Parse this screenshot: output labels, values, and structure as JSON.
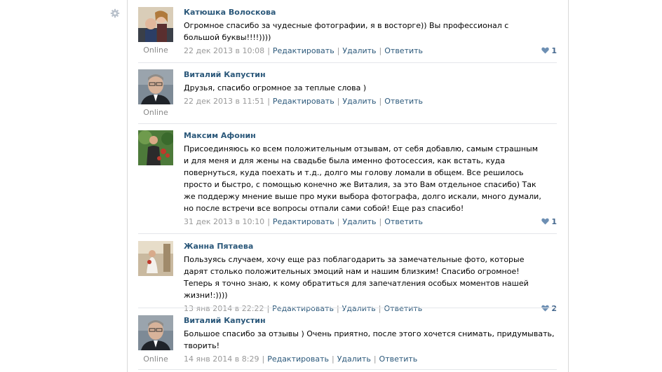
{
  "comments": [
    {
      "author": "Катюшка Волоскова",
      "text": "Огромное спасибо за чудесные фотографии, я в восторге)) Вы профессионал с большой буквы!!!!))))",
      "date": "22 дек 2013 в 10:08",
      "status": "Online",
      "likes": "1"
    },
    {
      "author": "Виталий Капустин",
      "text": "Друзья, спасибо огромное за теплые слова )",
      "date": "22 дек 2013 в 11:51",
      "status": "Online",
      "likes": ""
    },
    {
      "author": "Максим Афонин",
      "text": "Присоединяюсь ко всем положительным отзывам, от себя добавлю, самым страшным и для меня и для жены на свадьбе была именно фотосессия, как встать, куда повернуться, куда поехать и т.д., долго мы голову ломали в общем. Все решилось просто и быстро, с помощью конечно же Виталия, за это Вам отдельное спасибо) Так же поддержу мнение выше про муки выбора фотографа, долго искали, много думали, но после встречи все вопросы отпали сами собой! Еще раз спасибо!",
      "date": "31 дек 2013 в 10:10",
      "status": "",
      "likes": "1"
    },
    {
      "author": "Жанна Пятаева",
      "text": "Пользуясь случаем, хочу еще раз поблагодарить за замечательные фото, которые дарят столько положительных эмоций нам и нашим близким! Спасибо огромное! Теперь я точно знаю, к кому обратиться для запечатления особых моментов нашей жизни!:))))",
      "date": "13 янв 2014 в 22:22",
      "status": "",
      "likes": "2"
    },
    {
      "author": "Виталий Капустин",
      "text": "Большое спасибо за отзывы ) Очень приятно, после этого хочется снимать, придумывать, творить!",
      "date": "14 янв 2014 в 8:29",
      "status": "Online",
      "likes": ""
    }
  ],
  "actions": {
    "edit": "Редактировать",
    "delete": "Удалить",
    "reply": "Ответить"
  },
  "icons": {
    "settings": "gear-icon",
    "like": "heart-icon"
  },
  "colors": {
    "link": "#2b587a",
    "meta": "#999999",
    "like": "#45688e"
  }
}
